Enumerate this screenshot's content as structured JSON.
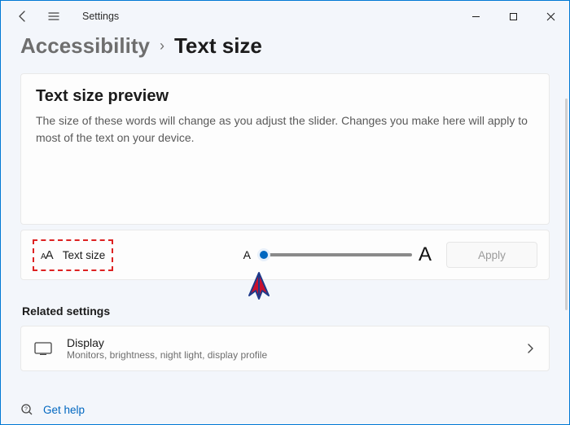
{
  "titlebar": {
    "title": "Settings"
  },
  "breadcrumb": {
    "parent": "Accessibility",
    "current": "Text size"
  },
  "preview": {
    "title": "Text size preview",
    "text": "The size of these words will change as you adjust the slider. Changes you make here will apply to most of the text on your device."
  },
  "textsize": {
    "label": "Text size",
    "small_marker": "A",
    "big_marker": "A",
    "apply_label": "Apply",
    "value": 0
  },
  "related": {
    "heading": "Related settings",
    "display_label": "Display",
    "display_desc": "Monitors, brightness, night light, display profile"
  },
  "help": {
    "label": "Get help"
  }
}
